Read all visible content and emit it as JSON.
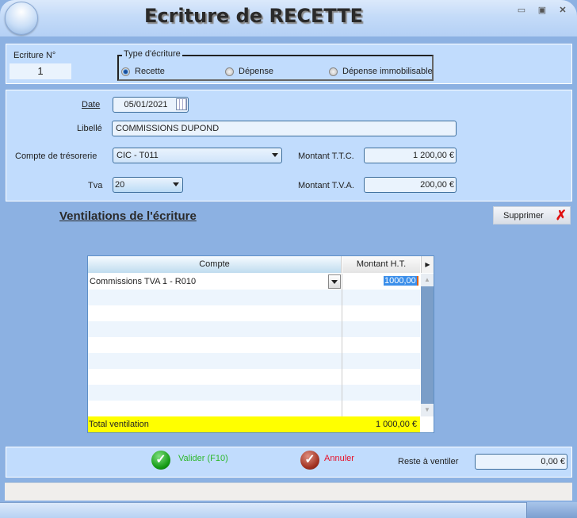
{
  "window": {
    "title": "Ecriture de RECETTE",
    "controls": [
      "minimize",
      "maximize",
      "close"
    ]
  },
  "header": {
    "ecriture_label": "Ecriture N°",
    "ecriture_value": "1",
    "type_label": "Type d'écriture",
    "types": [
      {
        "label": "Recette",
        "selected": true
      },
      {
        "label": "Dépense",
        "selected": false
      },
      {
        "label": "Dépense immobilisable",
        "selected": false
      }
    ]
  },
  "form": {
    "date_label": "Date",
    "date_value": "05/01/2021",
    "libelle_label": "Libellé",
    "libelle_value": "COMMISSIONS DUPOND",
    "compte_label": "Compte de trésorerie",
    "compte_value": "CIC - T011",
    "tva_label": "Tva",
    "tva_value": "20",
    "ttc_label": "Montant T.T.C.",
    "ttc_value": "1 200,00 €",
    "mtva_label": "Montant T.V.A.",
    "mtva_value": "200,00 €"
  },
  "ventilation": {
    "title": "Ventilations de l'écriture",
    "delete_label": "Supprimer",
    "columns": [
      "Compte",
      "Montant H.T."
    ],
    "rows": [
      {
        "compte": "Commissions TVA 1 - R010",
        "montant": "1000,00"
      }
    ],
    "total_label": "Total ventilation",
    "total_value": "1 000,00 €",
    "total_color": "#ffff00"
  },
  "footer": {
    "validate_label": "Valider (F10)",
    "cancel_label": "Annuler",
    "reste_label": "Reste à ventiler",
    "reste_value": "0,00 €",
    "validate_color": "#2db82d",
    "cancel_color": "#e8102a"
  }
}
